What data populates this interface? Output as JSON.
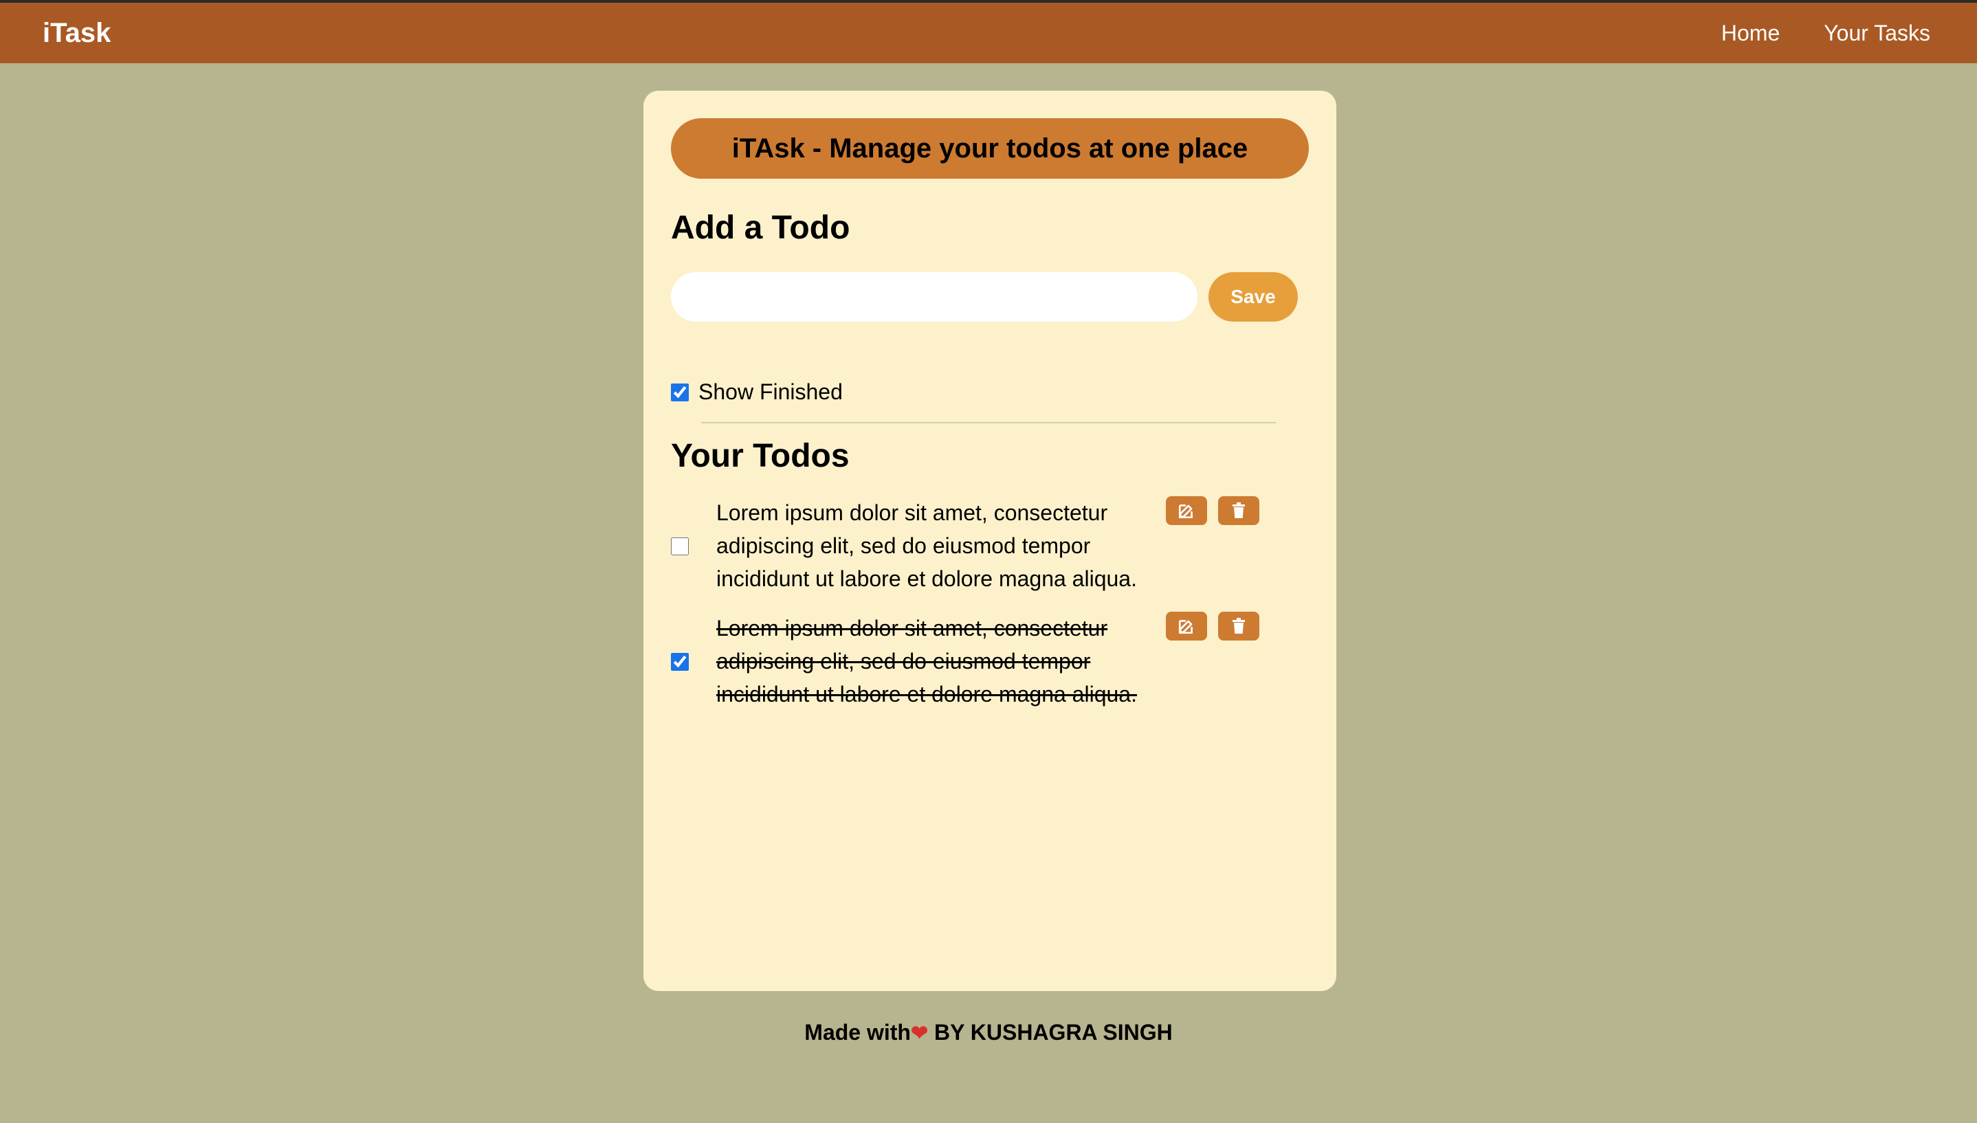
{
  "navbar": {
    "brand": "iTask",
    "links": [
      {
        "label": "Home"
      },
      {
        "label": "Your Tasks"
      }
    ]
  },
  "banner": {
    "title": "iTAsk - Manage your todos at one place"
  },
  "add_todo": {
    "heading": "Add a Todo",
    "input_value": "",
    "save_label": "Save"
  },
  "show_finished": {
    "label": "Show Finished",
    "checked": true
  },
  "todos_section": {
    "heading": "Your Todos",
    "items": [
      {
        "text": "Lorem ipsum dolor sit amet, consectetur adipiscing elit, sed do eiusmod tempor incididunt ut labore et dolore magna aliqua.",
        "completed": false
      },
      {
        "text": "Lorem ipsum dolor sit amet, consectetur adipiscing elit, sed do eiusmod tempor incididunt ut labore et dolore magna aliqua.",
        "completed": true
      }
    ],
    "edit_icon": "edit-icon",
    "delete_icon": "trash-icon"
  },
  "footer": {
    "prefix": "Made with",
    "heart_icon": "heart-icon",
    "suffix": " BY KUSHAGRA SINGH"
  },
  "colors": {
    "background": "#b7b58f",
    "navbar": "#a95924",
    "card": "#fcf1cb",
    "banner": "#cd7b31",
    "save_button": "#e69f3b",
    "action_button": "#cd7b31",
    "heart": "#d9312a"
  }
}
